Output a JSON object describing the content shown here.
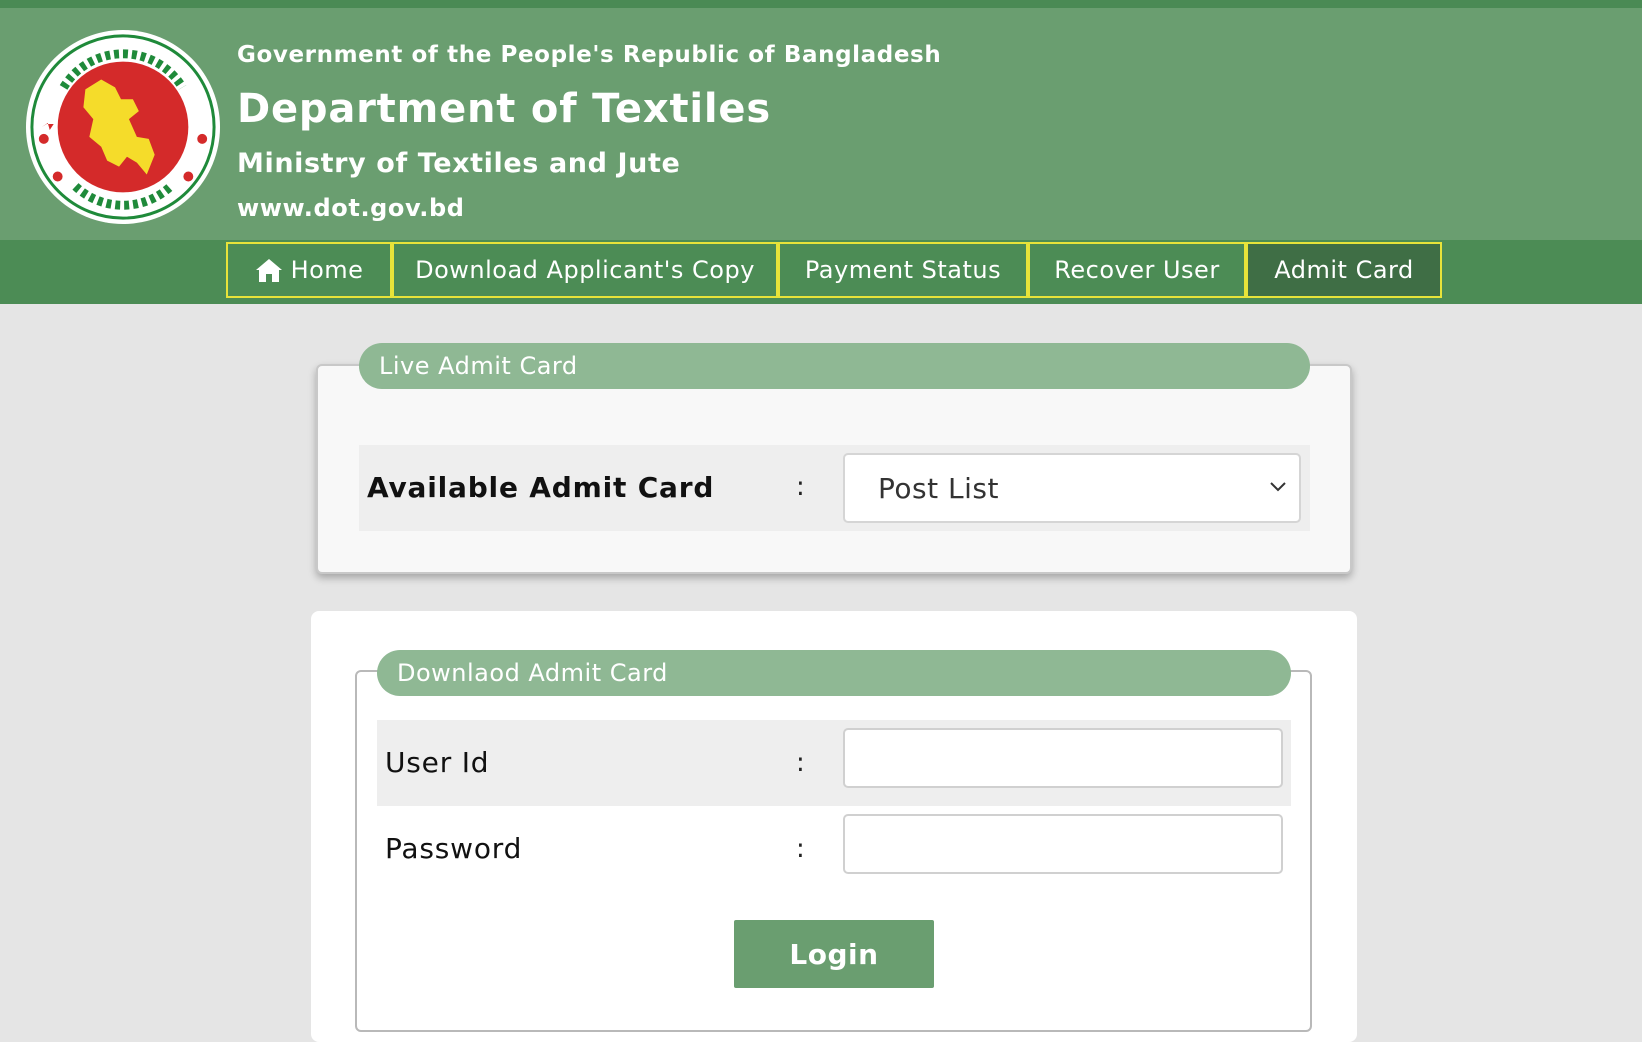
{
  "header": {
    "government_line": "Government of the People's Republic of Bangladesh",
    "department_title": "Department of Textiles",
    "ministry_line": "Ministry of Textiles and Jute",
    "website": "www.dot.gov.bd"
  },
  "nav": {
    "items": [
      {
        "label": "Home",
        "icon": "home-icon"
      },
      {
        "label": "Download Applicant's Copy"
      },
      {
        "label": "Payment Status"
      },
      {
        "label": "Recover User"
      },
      {
        "label": "Admit Card",
        "active": true
      }
    ]
  },
  "live_admit": {
    "legend": "Live Admit Card",
    "field_label": "Available Admit Card",
    "colon": ":",
    "select_value": "Post List"
  },
  "download_admit": {
    "legend": "Downlaod Admit Card",
    "user_id_label": "User Id",
    "password_label": "Password",
    "colon": ":",
    "user_id_value": "",
    "password_value": "",
    "login_label": "Login"
  },
  "colors": {
    "header_bg": "#6a9e70",
    "nav_bg": "#4c8c55",
    "nav_border": "#e7e33a",
    "legend_bg": "#8fb894",
    "button_bg": "#6a9e70"
  }
}
